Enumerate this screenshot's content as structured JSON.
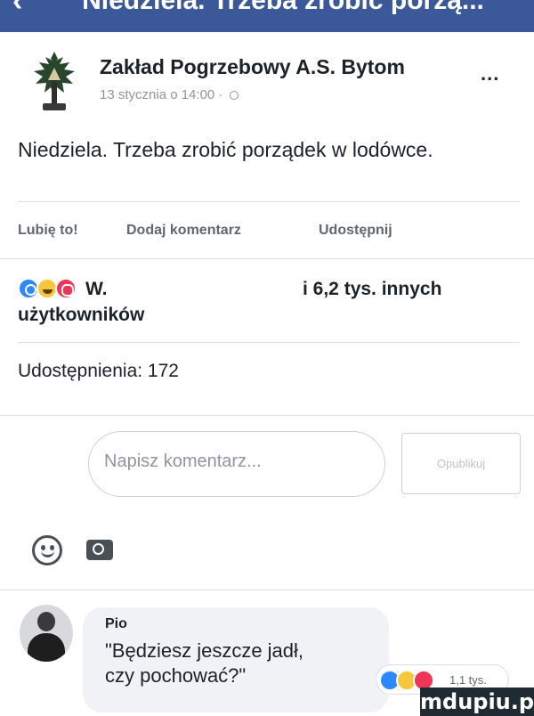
{
  "header": {
    "title": "Niedziela. Trzeba zrobić porzą...",
    "back_icon": "arrow-left-icon",
    "background": "#3b5998"
  },
  "post": {
    "author": "Zakład Pogrzebowy A.S. Bytom",
    "meta": "13 stycznia o 14:00 ·",
    "privacy_icon": "globe-icon",
    "more_label": "...",
    "text": "Niedziela. Trzeba zrobić porządek w lodówce."
  },
  "actions": {
    "like": "Lubię to!",
    "comment": "Dodaj komentarz",
    "share": "Udostępnij"
  },
  "reactions": {
    "icons": [
      "like-reaction-icon",
      "haha-reaction-icon",
      "love-reaction-icon"
    ],
    "name_fragment": "W.",
    "count_text": "i 6,2 tys. innych",
    "users_text": "użytkowników"
  },
  "shares": {
    "label": "Udostępnienia: 172"
  },
  "composer": {
    "placeholder": "Napisz komentarz...",
    "publish_label": "Opublikuj"
  },
  "comment": {
    "author": "Pio",
    "line1": "\"Będziesz jeszcze jadł,",
    "line2": "czy pochować?\"",
    "reaction_count": "1,1 tys."
  },
  "watermark": "mdupiu.pl",
  "colors": {
    "facebook_blue": "#3b5998",
    "like": "#2d88ff",
    "haha": "#f7c63a",
    "love": "#ee3656"
  }
}
